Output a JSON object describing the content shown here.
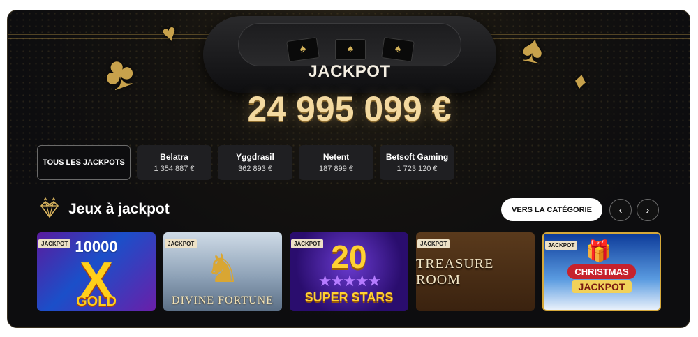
{
  "hero": {
    "title": "JACKPOT",
    "amount": "24 995 099 €"
  },
  "tabs": [
    {
      "label": "TOUS LES JACKPOTS",
      "amount": ""
    },
    {
      "label": "Belatra",
      "amount": "1 354 887 €"
    },
    {
      "label": "Yggdrasil",
      "amount": "362 893 €"
    },
    {
      "label": "Netent",
      "amount": "187 899 €"
    },
    {
      "label": "Betsoft Gaming",
      "amount": "1 723 120 €"
    }
  ],
  "section": {
    "title": "Jeux à jackpot",
    "category_button": "VERS LA CATÉGORIE",
    "prev_icon": "chevron-left-icon",
    "next_icon": "chevron-right-icon"
  },
  "games": [
    {
      "badge": "JACKPOT",
      "art_top": "10000",
      "art_mid": "X",
      "art_bottom": "GOLD"
    },
    {
      "badge": "JACKPOT",
      "art_title": "DIVINE FORTUNE"
    },
    {
      "badge": "JACKPOT",
      "art_top": "20",
      "art_title": "SUPER STARS"
    },
    {
      "badge": "JACKPOT",
      "art_title": "TREASURE ROOM"
    },
    {
      "badge": "JACKPOT",
      "art_top": "CHRISTMAS",
      "art_title": "JACKPOT"
    }
  ],
  "colors": {
    "accent_gold": "#f3d9a0",
    "panel_bg": "#0d0d0f",
    "tab_bg": "#1f1f22"
  }
}
